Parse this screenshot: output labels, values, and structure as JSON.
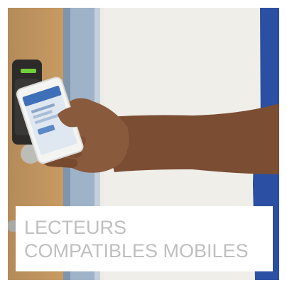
{
  "tile": {
    "caption": "LECTEURS COMPATIBLES MOBILES",
    "caption_color": "#bfbfbf"
  },
  "photo": {
    "subject": "hand holding a smartphone near a wall-mounted access control reader beside a door",
    "colors": {
      "wall": "#ecebe6",
      "door": "#c89a63",
      "frame": "#9fb3c8",
      "reader": "#2d2b2a",
      "reader_led": "#6fcf3a",
      "skin": "#8a5a3c",
      "shirt": "#2b4fa3",
      "phone": "#f4f4f2",
      "phone_screen": "#dfe7f1",
      "phone_header": "#3d70b8"
    }
  }
}
